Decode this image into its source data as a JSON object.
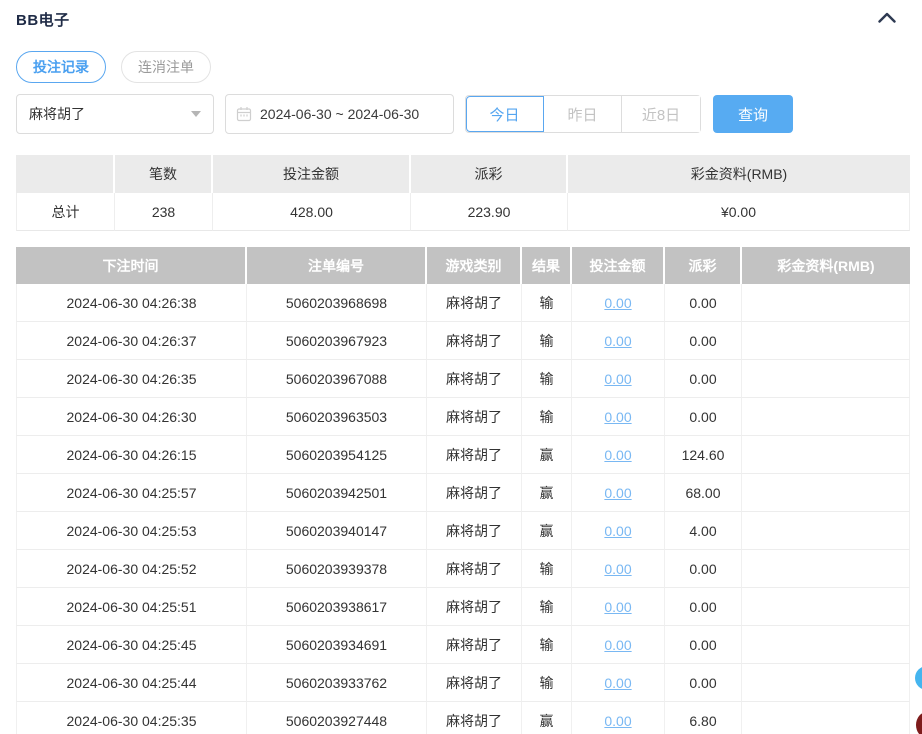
{
  "header": {
    "title": "BB电子"
  },
  "tabs": [
    {
      "label": "投注记录",
      "active": true
    },
    {
      "label": "连消注单",
      "active": false
    }
  ],
  "filters": {
    "game_select": {
      "value": "麻将胡了"
    },
    "date_range": {
      "value": "2024-06-30 ~ 2024-06-30"
    },
    "quick_buttons": [
      {
        "label": "今日",
        "active": true
      },
      {
        "label": "昨日",
        "active": false
      },
      {
        "label": "近8日",
        "active": false
      }
    ],
    "query_button": "查询"
  },
  "summary": {
    "headers": [
      "",
      "笔数",
      "投注金额",
      "派彩",
      "彩金资料(RMB)"
    ],
    "total": {
      "label": "总计",
      "count": "238",
      "bet_amount": "428.00",
      "payout": "223.90",
      "bonus": "¥0.00"
    }
  },
  "table": {
    "headers": [
      "下注时间",
      "注单编号",
      "游戏类别",
      "结果",
      "投注金额",
      "派彩",
      "彩金资料(RMB)"
    ],
    "rows": [
      [
        "2024-06-30 04:26:38",
        "5060203968698",
        "麻将胡了",
        "输",
        "0.00",
        "0.00",
        ""
      ],
      [
        "2024-06-30 04:26:37",
        "5060203967923",
        "麻将胡了",
        "输",
        "0.00",
        "0.00",
        ""
      ],
      [
        "2024-06-30 04:26:35",
        "5060203967088",
        "麻将胡了",
        "输",
        "0.00",
        "0.00",
        ""
      ],
      [
        "2024-06-30 04:26:30",
        "5060203963503",
        "麻将胡了",
        "输",
        "0.00",
        "0.00",
        ""
      ],
      [
        "2024-06-30 04:26:15",
        "5060203954125",
        "麻将胡了",
        "赢",
        "0.00",
        "124.60",
        ""
      ],
      [
        "2024-06-30 04:25:57",
        "5060203942501",
        "麻将胡了",
        "赢",
        "0.00",
        "68.00",
        ""
      ],
      [
        "2024-06-30 04:25:53",
        "5060203940147",
        "麻将胡了",
        "赢",
        "0.00",
        "4.00",
        ""
      ],
      [
        "2024-06-30 04:25:52",
        "5060203939378",
        "麻将胡了",
        "输",
        "0.00",
        "0.00",
        ""
      ],
      [
        "2024-06-30 04:25:51",
        "5060203938617",
        "麻将胡了",
        "输",
        "0.00",
        "0.00",
        ""
      ],
      [
        "2024-06-30 04:25:45",
        "5060203934691",
        "麻将胡了",
        "输",
        "0.00",
        "0.00",
        ""
      ],
      [
        "2024-06-30 04:25:44",
        "5060203933762",
        "麻将胡了",
        "输",
        "0.00",
        "0.00",
        ""
      ],
      [
        "2024-06-30 04:25:35",
        "5060203927448",
        "麻将胡了",
        "赢",
        "0.00",
        "6.80",
        ""
      ]
    ]
  },
  "icons": {
    "collapse": "chevron-up",
    "calendar": "calendar",
    "select_caret": "caret-down"
  },
  "colors": {
    "accent_blue": "#4da3f2",
    "query_button_bg": "#57abf2",
    "link_blue": "#79b8f3",
    "table_header_bg": "#c2c2c2",
    "summary_header_bg": "#ebebeb",
    "border": "#e8e8e8",
    "muted_text": "#c3c3c3",
    "title_text": "#1f2b46",
    "float_blue": "#45b5ef",
    "float_red": "#7e1c1c"
  }
}
